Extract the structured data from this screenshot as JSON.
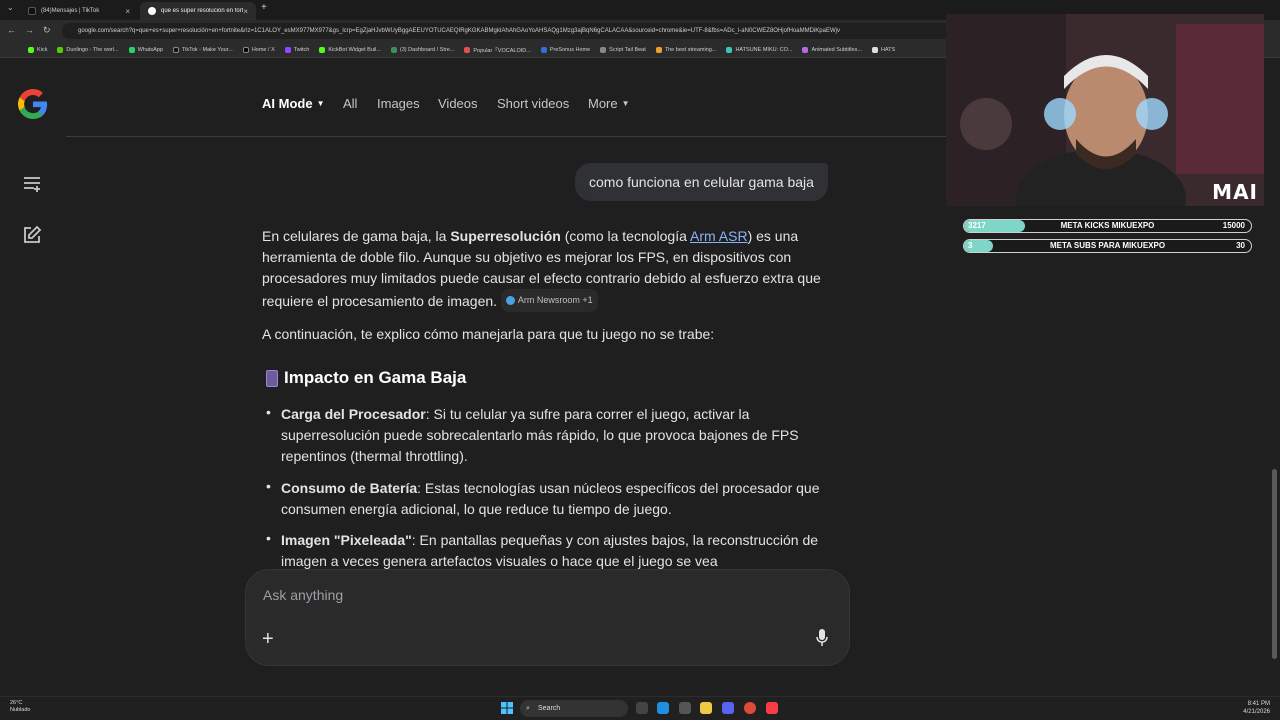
{
  "browser": {
    "tabs": [
      {
        "label": "(84)Mensajes | TikTok",
        "active": false
      },
      {
        "label": "que es super resolución en fort",
        "active": true
      }
    ],
    "url": "google.com/search?q=que+es+super+resolución+en+fortnite&rlz=1C1ALOY_esMX977MX977&gs_lcrp=EgZjaHJvbWUyBggAEEUYOTUCAEQIRgKGKABMgkIAhAhGAoYoAHSAQg1Mzg3ajBqN6gCALACAA&sourceid=chrome&ie=UTF-8&fbs=ADc_l-aN0CWEZ8OHjofHoaMMDiKpaEWjv",
    "bookmarks": [
      "Kick",
      "Duolingo - The worl...",
      "WhatsApp",
      "TikTok - Make Your...",
      "Home / X",
      "Twitch",
      "KickBot Widget Buil...",
      "(3) Dashboard / Stre...",
      "Popular「VOCALOID...",
      "PreSonus Home",
      "Script Tail Beat",
      "The best streaming...",
      "HATSUNE MIKU: CO...",
      "Animated Subtitles...",
      "HATS"
    ]
  },
  "nav": {
    "items": [
      {
        "label": "AI Mode",
        "active": true
      },
      {
        "label": "All"
      },
      {
        "label": "Images"
      },
      {
        "label": "Videos"
      },
      {
        "label": "Short videos"
      },
      {
        "label": "More"
      }
    ]
  },
  "chat": {
    "user_query": "como funciona en celular gama baja",
    "intro_pre": "En celulares de gama baja, la ",
    "intro_bold": "Superresolución",
    "intro_mid": " (como la tecnología ",
    "intro_link": "Arm ASR",
    "intro_post": ") es una herramienta de doble filo. Aunque su objetivo es mejorar los FPS, en dispositivos con procesadores muy limitados puede causar el efecto contrario debido al esfuerzo extra que requiere el procesamiento de imagen.",
    "source_chip": "Arm Newsroom +1",
    "followup": "A continuación, te explico cómo manejarla para que tu juego no se trabe:",
    "section_title": "Impacto en Gama Baja",
    "bullets": [
      {
        "title": "Carga del Procesador",
        "text": ": Si tu celular ya sufre para correr el juego, activar la superresolución puede sobrecalentarlo más rápido, lo que provoca bajones de FPS repentinos (thermal throttling)."
      },
      {
        "title": "Consumo de Batería",
        "text": ": Estas tecnologías usan núcleos específicos del procesador que consumen energía adicional, lo que reduce tu tiempo de juego."
      },
      {
        "title": "Imagen \"Pixeleada\"",
        "text": ": En pantallas pequeñas y con ajustes bajos, la reconstrucción de imagen a veces genera artefactos visuales o hace que el juego se vea"
      }
    ]
  },
  "ask": {
    "placeholder": "Ask anything"
  },
  "stream": {
    "cam_label": "MAI",
    "goals": [
      {
        "title": "META KICKS MIKUEXPO",
        "current": "3217",
        "target": "15000",
        "fraction": 0.214
      },
      {
        "title": "META SUBS PARA MIKUEXPO",
        "current": "3",
        "target": "30",
        "fraction": 0.1
      }
    ]
  },
  "taskbar": {
    "weather_temp": "26°C",
    "weather_desc": "Nublado",
    "search_label": "Search",
    "time": "8:41 PM",
    "date": "4/21/2026"
  },
  "colors": {
    "accent_link": "#8ab4f8",
    "goal_fill": "#7fd6c8",
    "background": "#1f1f1f"
  }
}
